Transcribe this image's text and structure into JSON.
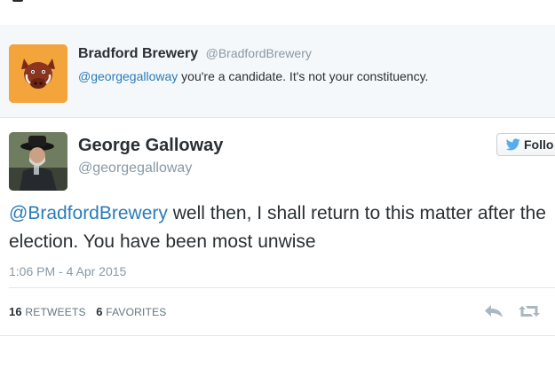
{
  "reply_context": {
    "name": "Bradford Brewery",
    "handle": "@BradfordBrewery",
    "mention": "@georgegalloway",
    "text": " you're a candidate. It's not your constituency.",
    "avatar_icon": "boar-logo",
    "avatar_color": "#f3a53b"
  },
  "tweet": {
    "name": "George Galloway",
    "handle": "@georgegalloway",
    "follow_label": "Follo",
    "mention": "@BradfordBrewery",
    "text": " well then, I shall return to this matter after the election. You have been most unwise",
    "timestamp": "1:06 PM - 4 Apr 2015",
    "retweets_count": "16",
    "retweets_label": "RETWEETS",
    "favorites_count": "6",
    "favorites_label": "FAVORITES",
    "avatar_icon": "profile-photo"
  },
  "colors": {
    "link": "#2b7bb9",
    "muted": "#8899a6",
    "text": "#292f33",
    "twitter_blue": "#55acee"
  },
  "icons": {
    "reply": "reply-icon",
    "retweet": "retweet-icon",
    "follow_bird": "twitter-bird-icon"
  }
}
